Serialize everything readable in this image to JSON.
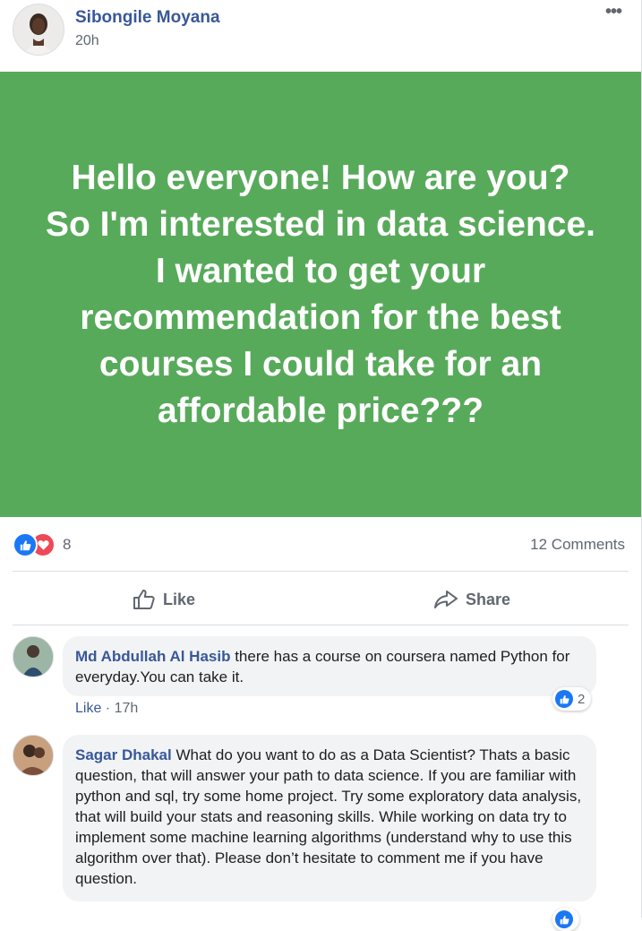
{
  "post": {
    "author": "Sibongile Moyana",
    "time": "20h",
    "more_icon": "•••",
    "text": "Hello everyone! How are you? So I'm interested in data science. I wanted to get your recommendation for the best courses I could take for an affordable price???",
    "background_color": "#58aa5b"
  },
  "stats": {
    "reaction_count": "8",
    "comments_count": "12 Comments",
    "reaction_icons": [
      "like-icon",
      "love-icon"
    ]
  },
  "actions": {
    "like_label": "Like",
    "share_label": "Share"
  },
  "comments": [
    {
      "name": "Md Abdullah Al Hasib",
      "text": " there has a course on coursera named Python for everyday.You can take it.",
      "like_label": "Like",
      "separator": " · ",
      "time": "17h",
      "reaction_count": "2"
    },
    {
      "name": "Sagar Dhakal",
      "text": " What do you want to do as a Data Scientist? Thats a basic question, that will answer your path to data science. If you are familiar with python and sql, try some home project. Try some exploratory data analysis, that will build your stats and reasoning skills. While working on data try to implement some machine learning algorithms (understand why to use this algorithm over that). Please don’t hesitate to comment me if you have question."
    }
  ],
  "colors": {
    "accent": "#385898",
    "like_blue": "#1a78f4",
    "love_red": "#ed4956",
    "muted": "#606770"
  }
}
